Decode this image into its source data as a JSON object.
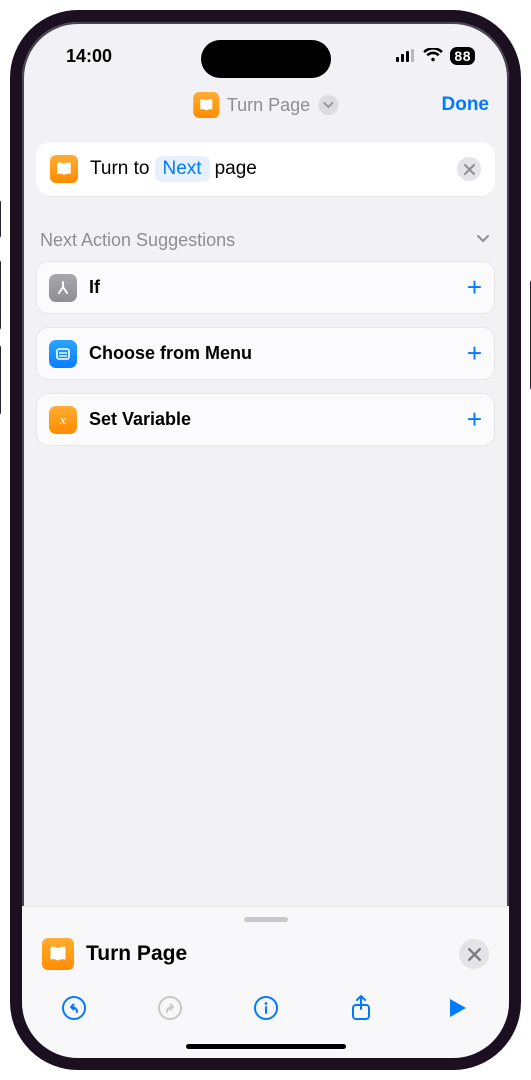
{
  "status": {
    "time": "14:00",
    "battery": "88"
  },
  "navbar": {
    "title": "Turn Page",
    "done": "Done"
  },
  "action": {
    "prefix": "Turn to",
    "param": "Next",
    "suffix": "page"
  },
  "suggestions": {
    "header": "Next Action Suggestions",
    "items": [
      {
        "label": "If"
      },
      {
        "label": "Choose from Menu"
      },
      {
        "label": "Set Variable"
      }
    ]
  },
  "sheet": {
    "title": "Turn Page"
  }
}
